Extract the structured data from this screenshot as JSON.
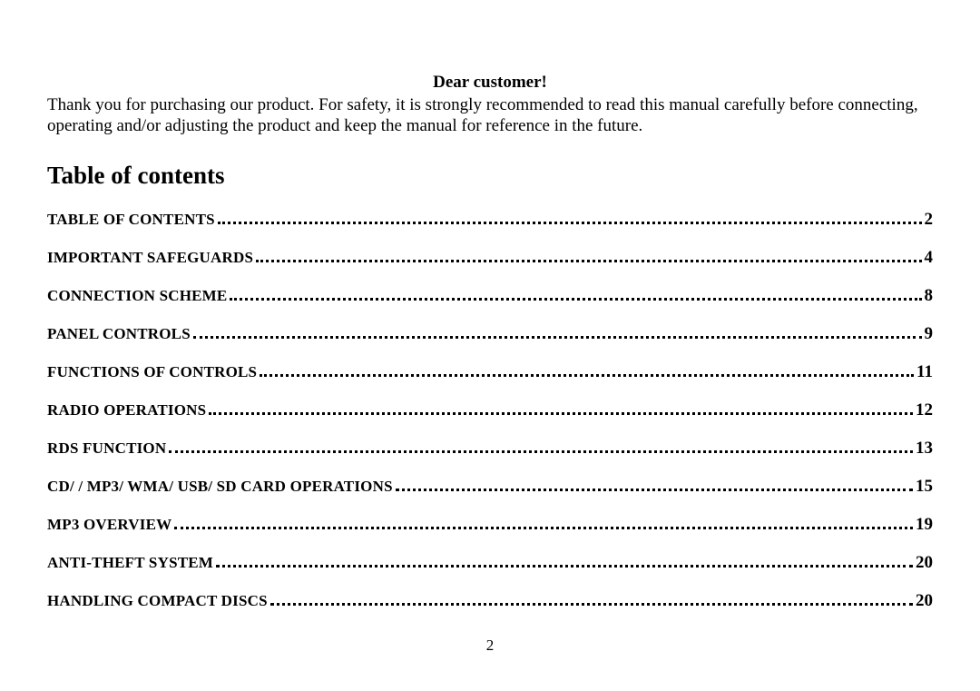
{
  "greeting": "Dear customer!",
  "intro": "Thank you for purchasing our product. For safety, it is strongly recommended to read this manual carefully before connecting, operating and/or adjusting the product and keep the manual for reference in the future.",
  "toc_heading": "Table of contents",
  "toc": [
    {
      "title": "TABLE OF CONTENTS",
      "page": "2"
    },
    {
      "title": "IMPORTANT SAFEGUARDS",
      "page": "4"
    },
    {
      "title": "CONNECTION SCHEME",
      "page": "8"
    },
    {
      "title": "PANEL CONTROLS",
      "page": "9"
    },
    {
      "title": "FUNCTIONS OF CONTROLS",
      "page": "11"
    },
    {
      "title": "RADIO OPERATIONS",
      "page": "12"
    },
    {
      "title": "RDS FUNCTION",
      "page": "13"
    },
    {
      "title": "CD/ / MP3/ WMA/ USB/ SD CARD OPERATIONS",
      "page": "15"
    },
    {
      "title": "MP3 OVERVIEW",
      "page": "19"
    },
    {
      "title": "ANTI-THEFT SYSTEM",
      "page": "20"
    },
    {
      "title": "HANDLING COMPACT DISCS",
      "page": "20"
    }
  ],
  "page_number": "2"
}
